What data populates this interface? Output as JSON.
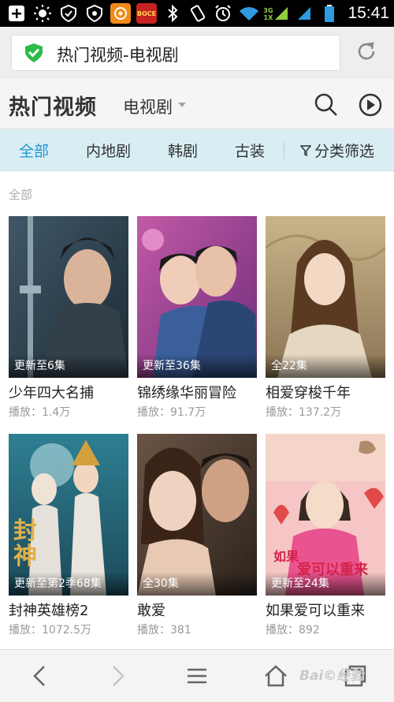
{
  "status_bar": {
    "time": "15:41",
    "net_label": "3G",
    "net_sub": "1X",
    "app_label": "BOCE"
  },
  "url_bar": {
    "text": "热门视频-电视剧"
  },
  "header": {
    "title": "热门视频",
    "category": "电视剧"
  },
  "tabs": [
    {
      "label": "全部",
      "active": true
    },
    {
      "label": "内地剧",
      "active": false
    },
    {
      "label": "韩剧",
      "active": false
    },
    {
      "label": "古装",
      "active": false
    }
  ],
  "filter_label": "分类筛选",
  "section_label": "全部",
  "cards": [
    {
      "badge": "更新至6集",
      "title": "少年四大名捕",
      "plays": "播放：1.4万"
    },
    {
      "badge": "更新至36集",
      "title": "锦绣缘华丽冒险",
      "plays": "播放：91.7万"
    },
    {
      "badge": "全22集",
      "title": "相爱穿梭千年",
      "plays": "播放：137.2万"
    },
    {
      "badge": "更新至第2季68集",
      "title": "封神英雄榜2",
      "plays": "播放：1072.5万"
    },
    {
      "badge": "全30集",
      "title": "敢爱",
      "plays": "播放：381"
    },
    {
      "badge": "更新至24集",
      "title": "如果爱可以重来",
      "plays": "播放：892"
    }
  ],
  "poster_text": {
    "fengshen": "封神",
    "ruguo_line1": "如果",
    "ruguo_line2": "爱可以重来"
  },
  "watermark": "Bai©经验",
  "colors": {
    "accent": "#2196d3",
    "tab_bg": "#d8eef3",
    "shield": "#2ebb4a"
  }
}
